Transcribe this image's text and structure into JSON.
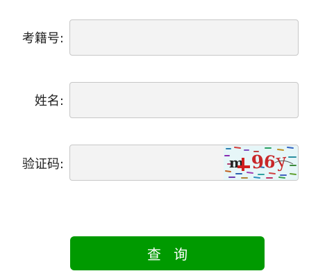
{
  "form": {
    "exam_number": {
      "label": "考籍号:",
      "value": "",
      "placeholder": ""
    },
    "name": {
      "label": "姓名:",
      "value": "",
      "placeholder": ""
    },
    "captcha": {
      "label": "验证码:",
      "value": "",
      "placeholder": "",
      "image_text": "m 96y"
    },
    "submit_label": "查 询"
  },
  "colors": {
    "submit_bg": "#009a00",
    "field_bg": "#f3f3f3",
    "field_border": "#c7c7c7"
  }
}
